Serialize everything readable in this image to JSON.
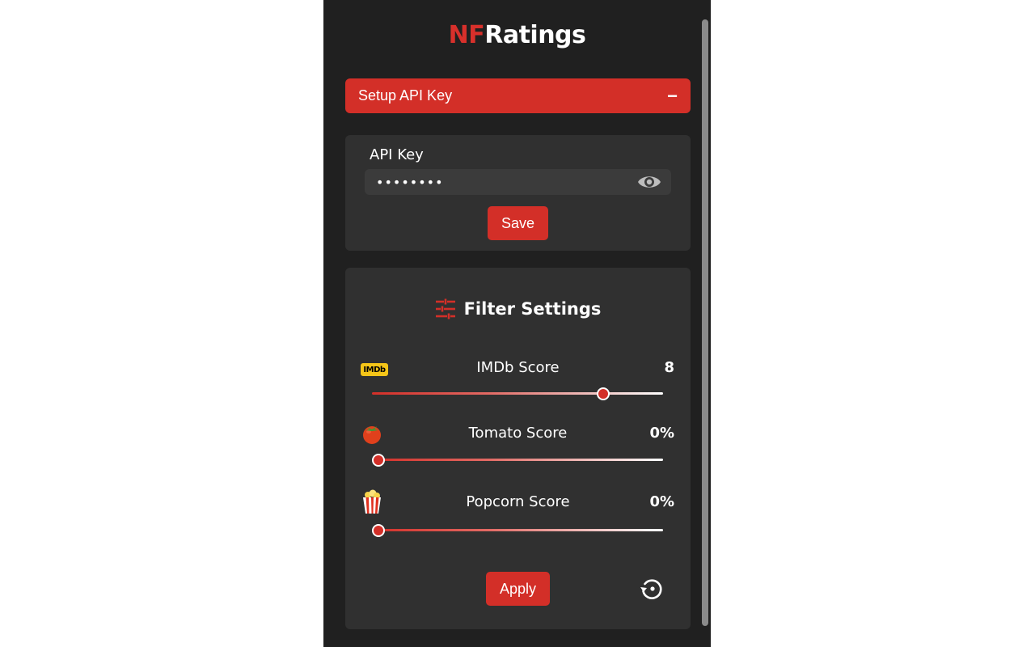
{
  "app": {
    "logo_prefix": "NF",
    "logo_suffix": "Ratings",
    "brand_color": "#d32f28"
  },
  "setup": {
    "title": "Setup API Key",
    "toggle": "−",
    "expanded": true
  },
  "api": {
    "label": "API Key",
    "value": "12345678",
    "masked": true,
    "save_label": "Save"
  },
  "filters": {
    "title": "Filter Settings",
    "title_icon": "sliders-icon",
    "items": [
      {
        "label": "IMDb Score",
        "icon": "imdb-logo-icon",
        "icon_text": "IMDb",
        "value": "8",
        "fraction": 0.79
      },
      {
        "label": "Tomato Score",
        "icon": "tomato-icon",
        "value": "0%",
        "fraction": 0
      },
      {
        "label": "Popcorn Score",
        "icon": "popcorn-icon",
        "value": "0%",
        "fraction": 0
      }
    ],
    "apply_label": "Apply",
    "reset_icon": "reset-icon"
  }
}
